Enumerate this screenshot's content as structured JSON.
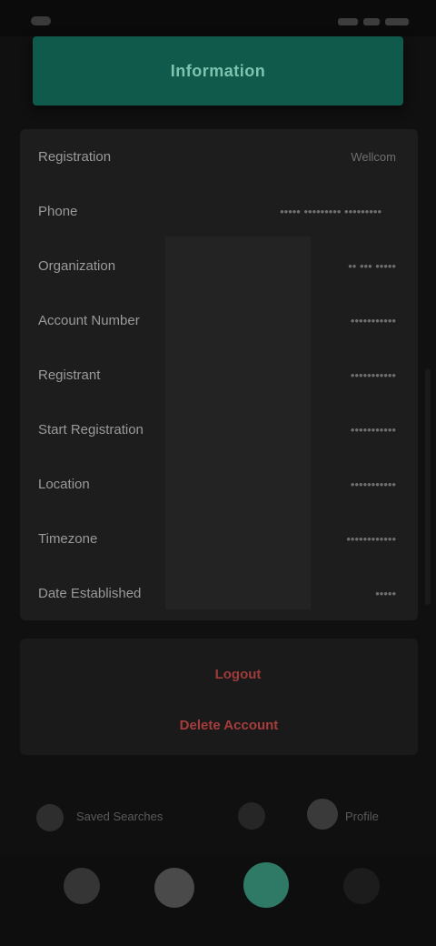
{
  "status_bar": {
    "time": "",
    "icons": [
      "signal-icon",
      "wifi-icon",
      "battery-icon"
    ]
  },
  "header": {
    "title": "Information"
  },
  "info_rows": [
    {
      "label": "Registration",
      "value": "Wellcom"
    },
    {
      "label": "Phone",
      "value": "••••• ••••••••• •••••••••"
    },
    {
      "label": "Organization",
      "value": "•• ••• •••••"
    },
    {
      "label": "Account Number",
      "value": "•••••••••••"
    },
    {
      "label": "Registrant",
      "value": "•••••••••••"
    },
    {
      "label": "Start Registration",
      "value": "•••••••••••"
    },
    {
      "label": "Location",
      "value": "•••••••••••"
    },
    {
      "label": "Timezone",
      "value": "••••••••••••"
    },
    {
      "label": "Date Established",
      "value": "•••••"
    }
  ],
  "danger_zone": {
    "primary_label": "Logout",
    "secondary_label": "Delete Account"
  },
  "mini_bar": {
    "left_label": "Saved Searches",
    "right_label": "Profile"
  },
  "bottom_nav": {
    "items": [
      "home-icon",
      "search-icon",
      "add-icon",
      "menu-icon"
    ]
  },
  "colors": {
    "accent": "#0f5a4a",
    "danger": "#a63c3c",
    "background": "#101010",
    "card": "#1d1d1d"
  }
}
